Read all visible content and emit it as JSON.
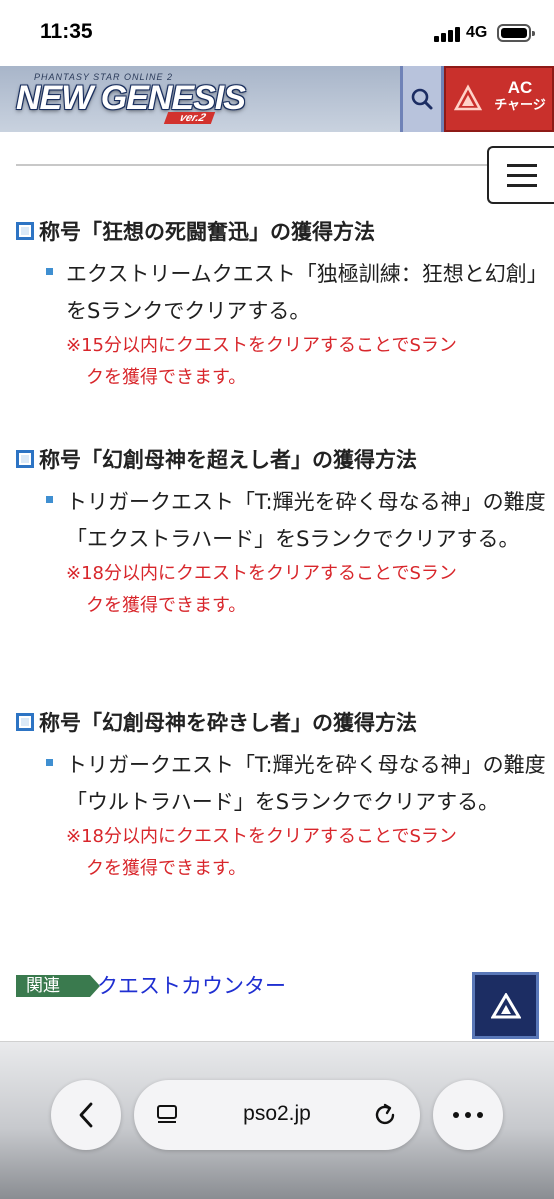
{
  "status_bar": {
    "time": "11:35",
    "network": "4G"
  },
  "header": {
    "logo_sub": "PHANTASY STAR ONLINE 2",
    "logo_main": "NEW GENESIS",
    "logo_version": "ver.2",
    "search_icon": "search-icon",
    "ac_line1": "AC",
    "ac_line2": "チャージ"
  },
  "sections": [
    {
      "heading": "称号「狂想の死闘奮迅」の獲得方法",
      "body": "エクストリームクエスト「独極訓練：狂想と幻創」をSランクでクリアする。",
      "note_line1": "※15分以内にクエストをクリアすることでSラン",
      "note_line2": "クを獲得できます。"
    },
    {
      "heading": "称号「幻創母神を超えし者」の獲得方法",
      "body": "トリガークエスト「T:輝光を砕く母なる神」の難度「エクストラハード」をSランクでクリアする。",
      "note_line1": "※18分以内にクエストをクリアすることでSラン",
      "note_line2": "クを獲得できます。"
    },
    {
      "heading": "称号「幻創母神を砕きし者」の獲得方法",
      "body": "トリガークエスト「T:輝光を砕く母なる神」の難度「ウルトラハード」をSランクでクリアする。",
      "note_line1": "※18分以内にクエストをクリアすることでSラン",
      "note_line2": "クを獲得できます。"
    }
  ],
  "related": {
    "label": "関連",
    "link": "クエストカウンター"
  },
  "browser": {
    "url": "pso2.jp"
  },
  "colors": {
    "accent_blue": "#2d74c4",
    "note_red": "#d8262b",
    "link_blue": "#1f2fd1",
    "related_green": "#3a7a4e",
    "ac_red": "#c9302c"
  }
}
